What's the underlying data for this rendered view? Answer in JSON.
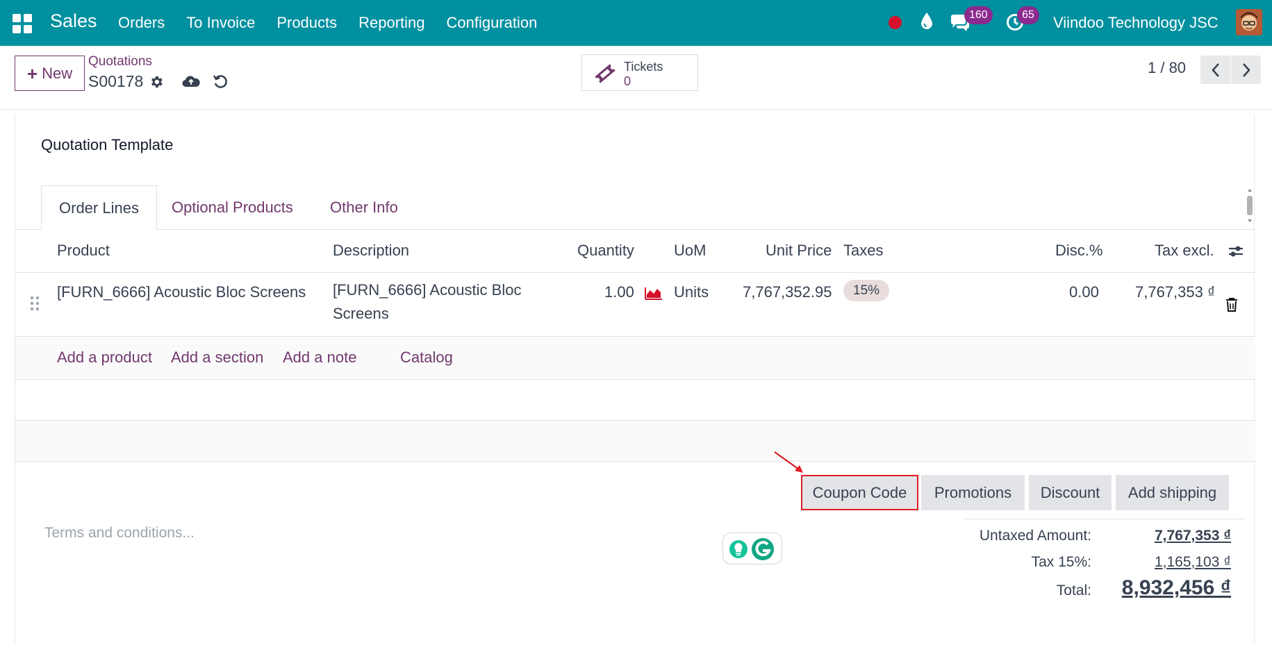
{
  "topbar": {
    "app_name": "Sales",
    "menu": [
      "Orders",
      "To Invoice",
      "Products",
      "Reporting",
      "Configuration"
    ],
    "messages_count": "160",
    "activities_count": "65",
    "company": "Viindoo Technology JSC",
    "bg_color": "#00909f"
  },
  "control": {
    "new_label": "New",
    "breadcrumb": "Quotations",
    "record_name": "S00178",
    "tickets_label": "Tickets",
    "tickets_count": "0",
    "pager": "1 / 80"
  },
  "form": {
    "field_label": "Quotation Template",
    "tabs": [
      "Order Lines",
      "Optional Products",
      "Other Info"
    ],
    "columns": {
      "product": "Product",
      "description": "Description",
      "quantity": "Quantity",
      "uom": "UoM",
      "unit_price": "Unit Price",
      "taxes": "Taxes",
      "discount": "Disc.%",
      "subtotal": "Tax excl."
    },
    "line": {
      "product": "[FURN_6666] Acoustic Bloc Screens",
      "description_1": "[FURN_6666] Acoustic Bloc",
      "description_2": "Screens",
      "quantity": "1.00",
      "uom": "Units",
      "unit_price": "7,767,352.95",
      "tax": "15%",
      "discount": "0.00",
      "subtotal": "7,767,353 ₫"
    },
    "add_links": [
      "Add a product",
      "Add a section",
      "Add a note",
      "Catalog"
    ],
    "actions": [
      "Coupon Code",
      "Promotions",
      "Discount",
      "Add shipping"
    ],
    "terms_placeholder": "Terms and conditions...",
    "totals": {
      "untaxed_label": "Untaxed Amount:",
      "untaxed_value": "7,767,353 ₫",
      "tax_label": "Tax 15%:",
      "tax_value": "1,165,103 ₫",
      "total_label": "Total:",
      "total_value": "8,932,456 ₫"
    }
  }
}
